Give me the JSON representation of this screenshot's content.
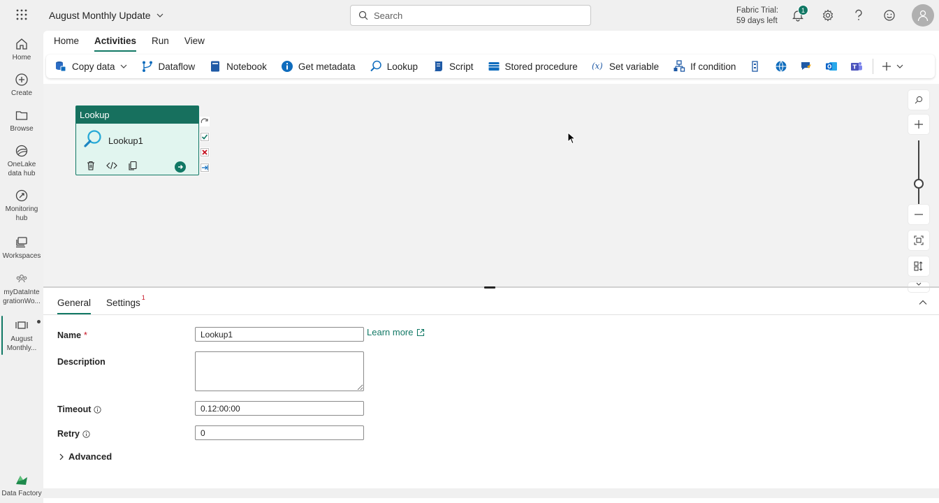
{
  "header": {
    "title": "August Monthly Update",
    "search_placeholder": "Search",
    "trial_line1": "Fabric Trial:",
    "trial_line2": "59 days left",
    "notification_count": "1"
  },
  "rail": {
    "items": [
      {
        "label": "Home"
      },
      {
        "label": "Create"
      },
      {
        "label": "Browse"
      },
      {
        "label1": "OneLake",
        "label2": "data hub"
      },
      {
        "label1": "Monitoring",
        "label2": "hub"
      },
      {
        "label": "Workspaces"
      },
      {
        "label1": "myDataInte",
        "label2": "grationWo..."
      },
      {
        "label1": "August",
        "label2": "Monthly..."
      }
    ],
    "footer_label": "Data Factory"
  },
  "tabs": [
    "Home",
    "Activities",
    "Run",
    "View"
  ],
  "toolbar": {
    "copy_data": "Copy data",
    "dataflow": "Dataflow",
    "notebook": "Notebook",
    "get_metadata": "Get metadata",
    "lookup": "Lookup",
    "script": "Script",
    "stored_procedure": "Stored procedure",
    "set_variable": "Set variable",
    "if_condition": "If condition"
  },
  "activity": {
    "type": "Lookup",
    "name": "Lookup1"
  },
  "properties": {
    "tabs": {
      "general": "General",
      "settings": "Settings",
      "settings_badge": "1"
    },
    "name_label": "Name",
    "name_required": "*",
    "name_value": "Lookup1",
    "learn_more": "Learn more",
    "description_label": "Description",
    "description_value": "",
    "timeout_label": "Timeout",
    "timeout_value": "0.12:00:00",
    "retry_label": "Retry",
    "retry_value": "0",
    "advanced": "Advanced"
  },
  "colors": {
    "accent": "#117865",
    "activity_header": "#17705e",
    "activity_body": "#e1f5ef",
    "error": "#c50f1f"
  }
}
